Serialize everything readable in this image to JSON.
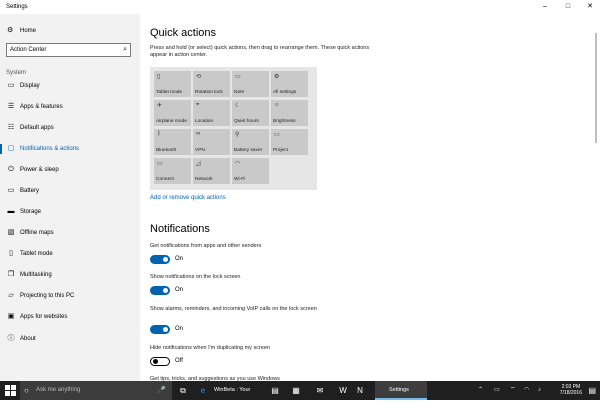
{
  "window": {
    "title": "Settings",
    "controls": {
      "minimize": "–",
      "maximize": "□",
      "close": "✕"
    }
  },
  "sidebar": {
    "home_icon": "⚙",
    "home_label": "Home",
    "search_value": "Action Center",
    "search_icon": "⌕",
    "section_label": "System",
    "items": [
      {
        "label": "Display",
        "icon": "▭"
      },
      {
        "label": "Apps & features",
        "icon": "☰"
      },
      {
        "label": "Default apps",
        "icon": "☷"
      },
      {
        "label": "Notifications & actions",
        "icon": "▢"
      },
      {
        "label": "Power & sleep",
        "icon": "⏻"
      },
      {
        "label": "Battery",
        "icon": "▭"
      },
      {
        "label": "Storage",
        "icon": "▬"
      },
      {
        "label": "Offline maps",
        "icon": "▧"
      },
      {
        "label": "Tablet mode",
        "icon": "▯"
      },
      {
        "label": "Multitasking",
        "icon": "❐"
      },
      {
        "label": "Projecting to this PC",
        "icon": "▱"
      },
      {
        "label": "Apps for websites",
        "icon": "▣"
      },
      {
        "label": "About",
        "icon": "ⓘ"
      }
    ],
    "active_index": 3
  },
  "main": {
    "quick_actions_heading": "Quick actions",
    "quick_actions_desc": "Press and hold (or select) quick actions, then drag to rearrange them. These quick actions appear in action center.",
    "tiles": [
      {
        "label": "Tablet mode",
        "icon": "▯"
      },
      {
        "label": "Rotation lock",
        "icon": "⟲"
      },
      {
        "label": "Note",
        "icon": "▭"
      },
      {
        "label": "All settings",
        "icon": "⚙"
      },
      {
        "label": "Airplane mode",
        "icon": "✈"
      },
      {
        "label": "Location",
        "icon": "⌖"
      },
      {
        "label": "Quiet hours",
        "icon": "☾"
      },
      {
        "label": "Brightness",
        "icon": "☼"
      },
      {
        "label": "Bluetooth",
        "icon": "ᛒ"
      },
      {
        "label": "VPN",
        "icon": "∞"
      },
      {
        "label": "Battery saver",
        "icon": "⚲"
      },
      {
        "label": "Project",
        "icon": "▭"
      },
      {
        "label": "Connect",
        "icon": "▭"
      },
      {
        "label": "Network",
        "icon": "◿"
      },
      {
        "label": "Wi-Fi",
        "icon": "◠"
      }
    ],
    "add_remove_link": "Add or remove quick actions",
    "notifications_heading": "Notifications",
    "settings": [
      {
        "label": "Get notifications from apps and other senders",
        "state": "On"
      },
      {
        "label": "Show notifications on the lock screen",
        "state": "On"
      },
      {
        "label": "Show alarms, reminders, and incoming VoIP calls on the lock screen",
        "state": "On"
      },
      {
        "label": "Hide notifications when I'm duplicating my screen",
        "state": "Off"
      },
      {
        "label": "Get tips, tricks, and suggestions as you use Windows",
        "state": ""
      }
    ]
  },
  "taskbar": {
    "search_placeholder": "Ask me anything",
    "search_icon": "○",
    "mic_icon": "🎤",
    "task_view_icon": "⧉",
    "edge_icon": "e",
    "windows": [
      {
        "label": "WinBeta : Your sour...",
        "active": false
      },
      {
        "label": "Settings",
        "active": true
      }
    ],
    "pinned": [
      {
        "icon": "▤",
        "name": "file-explorer-icon"
      },
      {
        "icon": "▦",
        "name": "store-icon"
      },
      {
        "icon": "✉",
        "name": "mail-icon"
      },
      {
        "icon": "W",
        "name": "word-icon"
      },
      {
        "icon": "N",
        "name": "netflix-icon"
      },
      {
        "icon": "▣",
        "name": "xbox-icon"
      }
    ],
    "tray": [
      {
        "icon": "⌃",
        "name": "tray-chevron-icon"
      },
      {
        "icon": "▭",
        "name": "battery-icon"
      },
      {
        "icon": "⌔",
        "name": "pen-icon"
      },
      {
        "icon": "◠",
        "name": "wifi-icon"
      },
      {
        "icon": "♪",
        "name": "volume-icon"
      }
    ],
    "time": "2:03 PM",
    "date": "7/18/2016",
    "notification_icon": "▤"
  },
  "colors": {
    "accent": "#0063b1",
    "sidebar_bg": "#f2f2f2",
    "taskbar_bg": "#1f1f1f",
    "tile_bg": "#c9c9c9"
  }
}
